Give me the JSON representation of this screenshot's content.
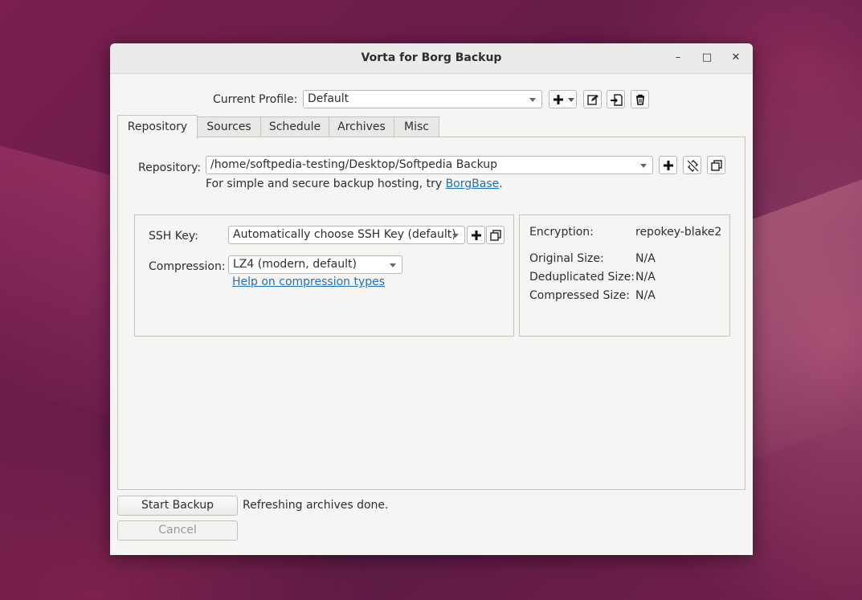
{
  "window": {
    "title": "Vorta for Borg Backup",
    "controls": {
      "minimize": "–",
      "maximize": "□",
      "close": "✕"
    }
  },
  "profile": {
    "label": "Current Profile:",
    "value": "Default",
    "buttons": [
      "add-icon",
      "dropdown-icon",
      "edit-icon",
      "import-icon",
      "trash-icon"
    ]
  },
  "tabs": [
    {
      "label": "Repository",
      "active": true
    },
    {
      "label": "Sources"
    },
    {
      "label": "Schedule"
    },
    {
      "label": "Archives"
    },
    {
      "label": "Misc"
    }
  ],
  "repository": {
    "label": "Repository:",
    "value": "/home/softpedia-testing/Desktop/Softpedia Backup",
    "hint_prefix": "For simple and secure backup hosting, try ",
    "hint_link": "BorgBase",
    "hint_suffix": "."
  },
  "settings": {
    "ssh_label": "SSH Key:",
    "ssh_value": "Automatically choose SSH Key (default)",
    "compression_label": "Compression:",
    "compression_value": "LZ4 (modern, default)",
    "compression_help": "Help on compression types"
  },
  "info": {
    "encryption_label": "Encryption:",
    "encryption_value": "repokey-blake2",
    "original_label": "Original Size:",
    "original_value": "N/A",
    "dedup_label": "Deduplicated Size:",
    "dedup_value": "N/A",
    "compressed_label": "Compressed Size:",
    "compressed_value": "N/A"
  },
  "footer": {
    "start_label": "Start Backup",
    "status": "Refreshing archives done.",
    "cancel_label": "Cancel"
  }
}
